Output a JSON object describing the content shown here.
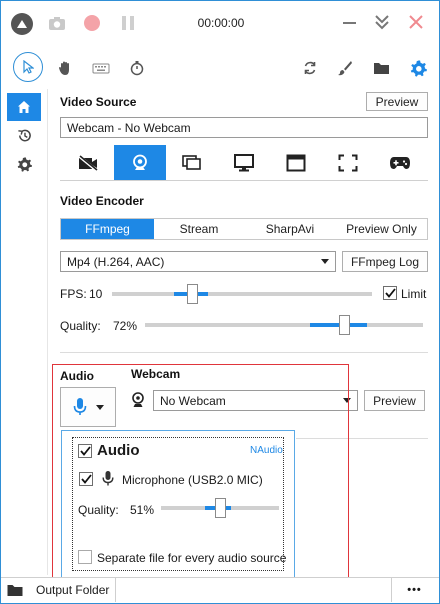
{
  "titlebar": {
    "timer": "00:00:00"
  },
  "video_source": {
    "title": "Video Source",
    "preview_label": "Preview",
    "current_source": "Webcam  -  No Webcam"
  },
  "video_encoder": {
    "title": "Video Encoder",
    "tabs": [
      "FFmpeg",
      "Stream",
      "SharpAvi",
      "Preview Only"
    ],
    "active_tab": "FFmpeg",
    "codec_value": "Mp4 (H.264, AAC)",
    "ffmpeg_log_label": "FFmpeg Log",
    "fps_label": "FPS:",
    "fps_value": "10",
    "limit_label": "Limit",
    "limit_checked": true,
    "quality_label": "Quality:",
    "quality_value": "72%",
    "quality_level": 0.72
  },
  "audio": {
    "title": "Audio",
    "popup": {
      "header": "Audio",
      "provider": "NAudio",
      "device_label": "Microphone (USB2.0 MIC)",
      "device_checked": true,
      "quality_label": "Quality:",
      "quality_value": "51%",
      "quality_level": 0.51,
      "separate_label": "Separate file for every audio source",
      "separate_checked": false
    }
  },
  "webcam": {
    "title": "Webcam",
    "selected": "No Webcam",
    "preview_label": "Preview"
  },
  "bottombar": {
    "output_folder_label": "Output Folder",
    "more_label": "•••"
  },
  "colors": {
    "accent": "#1e88e5",
    "record_disabled": "#f4a3a8",
    "close_x": "#f08a8f",
    "highlight_box": "#e0353b"
  }
}
